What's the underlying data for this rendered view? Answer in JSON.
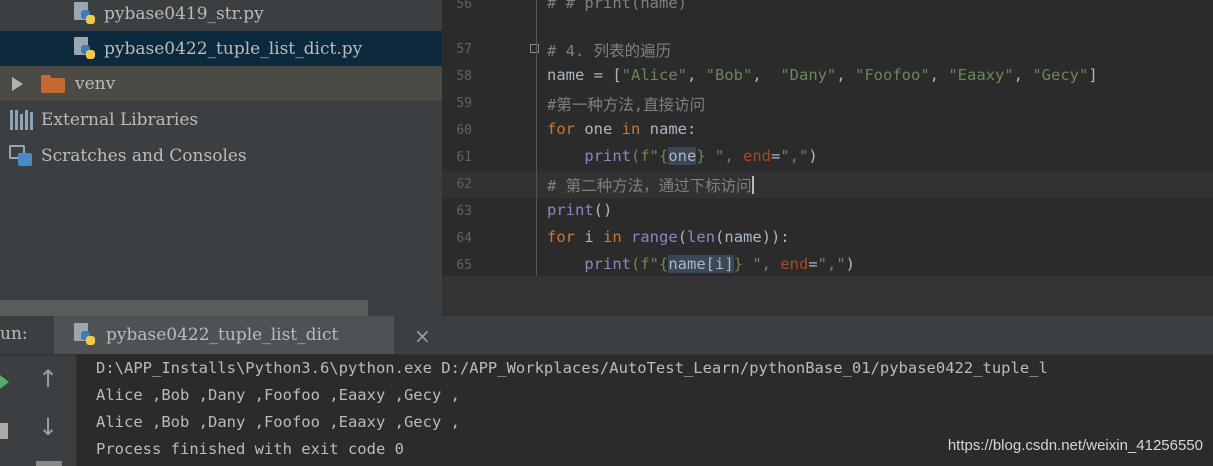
{
  "tree": {
    "items": [
      {
        "label": "pybase0419_str.py",
        "icon": "python-file-icon"
      },
      {
        "label": "pybase0422_tuple_list_dict.py",
        "icon": "python-file-icon",
        "selected": true
      },
      {
        "label": "venv",
        "icon": "folder-icon"
      },
      {
        "label": "External Libraries",
        "icon": "libraries-icon"
      },
      {
        "label": "Scratches and Consoles",
        "icon": "scratches-icon"
      }
    ]
  },
  "editor": {
    "lines": [
      {
        "num": "56",
        "text": "# # print(name)"
      },
      {
        "num": "57",
        "comment": "# 4. 列表的遍历"
      },
      {
        "num": "58",
        "var": "name",
        "op": " = [",
        "s1": "\"Alice\"",
        "s2": "\"Bob\"",
        "s3": "\"Dany\"",
        "s4": "\"Foofoo\"",
        "s5": "\"Eaaxy\"",
        "s6": "\"Gecy\"",
        "close": "]"
      },
      {
        "num": "59",
        "comment": "#第一种方法,直接访问"
      },
      {
        "num": "60",
        "kw1": "for",
        "mid": " one ",
        "kw2": "in",
        "rest": " name:"
      },
      {
        "num": "61",
        "fn": "print",
        "p1": "(f\"{",
        "var": "one",
        "p2": "} \", ",
        "kwarg": "end",
        "p3": "=",
        "str": "\",\"",
        "p4": ")"
      },
      {
        "num": "62",
        "comment": "# 第二种方法，通过下标访问"
      },
      {
        "num": "63",
        "fn": "print",
        "rest": "()"
      },
      {
        "num": "64",
        "kw1": "for",
        "mid": " i ",
        "kw2": "in",
        "sp": " ",
        "fn1": "range",
        "p1": "(",
        "fn2": "len",
        "rest": "(name)):"
      },
      {
        "num": "65",
        "fn": "print",
        "p1": "(f\"{",
        "var": "name[i]",
        "p2": "} \", ",
        "kwarg": "end",
        "p3": "=",
        "str": "\",\"",
        "p4": ")"
      }
    ]
  },
  "run": {
    "label": "un:",
    "tab_title": "pybase0422_tuple_list_dict",
    "close": "×",
    "up_arrow": "↑",
    "down_arrow": "↓",
    "output": [
      "D:\\APP_Installs\\Python3.6\\python.exe D:/APP_Workplaces/AutoTest_Learn/pythonBase_01/pybase0422_tuple_l",
      "Alice ,Bob ,Dany ,Foofoo ,Eaaxy ,Gecy ,",
      "Alice ,Bob ,Dany ,Foofoo ,Eaaxy ,Gecy ,",
      "Process finished with exit code 0"
    ]
  },
  "watermark": "https://blog.csdn.net/weixin_41256550",
  "colors": {
    "keyword": "#cc7832",
    "string": "#6a8759",
    "comment": "#808080",
    "builtin": "#8888c6",
    "kwarg": "#aa4926"
  }
}
